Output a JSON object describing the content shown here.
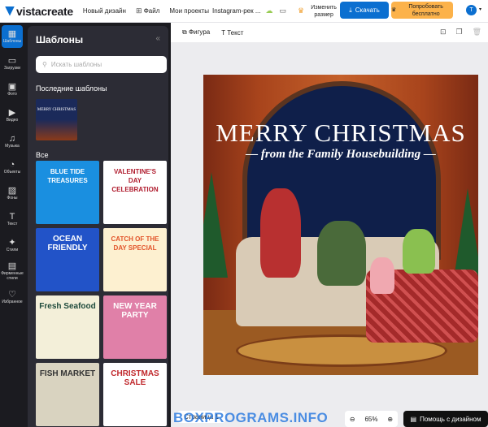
{
  "topbar": {
    "logo": "vistacreate",
    "new_design": "Новый дизайн",
    "file": "Файл",
    "breadcrumb": "Мои проекты",
    "project_name": "Instagram-рек ...",
    "resize": "Изменить размер",
    "download": "Скачать",
    "try_free": "Попробовать бесплатно",
    "avatar_initial": "T"
  },
  "rail": [
    {
      "label": "Шаблоны",
      "icon": "▦"
    },
    {
      "label": "Загрузки",
      "icon": "▭"
    },
    {
      "label": "Фото",
      "icon": "▣"
    },
    {
      "label": "Видео",
      "icon": "▶"
    },
    {
      "label": "Музыка",
      "icon": "♫"
    },
    {
      "label": "Объекты",
      "icon": "◔"
    },
    {
      "label": "Фоны",
      "icon": "▨"
    },
    {
      "label": "Текст",
      "icon": "T"
    },
    {
      "label": "Стили",
      "icon": "✦"
    },
    {
      "label": "Фирменные стили",
      "icon": "▤"
    },
    {
      "label": "Избранное",
      "icon": "♡"
    }
  ],
  "panel": {
    "title": "Шаблоны",
    "collapse": "«",
    "search_placeholder": "Искать шаблоны",
    "recent_title": "Последние шаблоны",
    "recent_thumb": "MERRY CHRISTMAS",
    "all_title": "Все",
    "templates": [
      {
        "title": "BLUE TIDE TREASURES",
        "bg": "#1a8fe0",
        "fg": "#fff"
      },
      {
        "title": "VALENTINE'S DAY CELEBRATION",
        "bg": "#ffffff",
        "fg": "#b01c2e"
      },
      {
        "title": "OCEAN FRIENDLY",
        "bg": "#2253c8",
        "fg": "#fff"
      },
      {
        "title": "CATCH OF THE DAY SPECIAL",
        "bg": "#fdf0d0",
        "fg": "#e2542a"
      },
      {
        "title": "Fresh Seafood",
        "bg": "#f3efd9",
        "fg": "#1e4a3c"
      },
      {
        "title": "NEW YEAR PARTY",
        "bg": "#e080a8",
        "fg": "#fff"
      },
      {
        "title": "FISH MARKET",
        "bg": "#d9d3c0",
        "fg": "#333"
      },
      {
        "title": "CHRISTMAS SALE",
        "bg": "#ffffff",
        "fg": "#c0282c"
      }
    ]
  },
  "toolbar": {
    "shape": "Фигура",
    "text": "Текст"
  },
  "design": {
    "title": "MERRY CHRISTMAS",
    "subtitle": "from the Family Housebuilding"
  },
  "footer": {
    "pages": "Страница 1",
    "zoom": "65%",
    "help": "Помощь с дизайном",
    "watermark": "BOXPROGRAMS.INFO"
  }
}
